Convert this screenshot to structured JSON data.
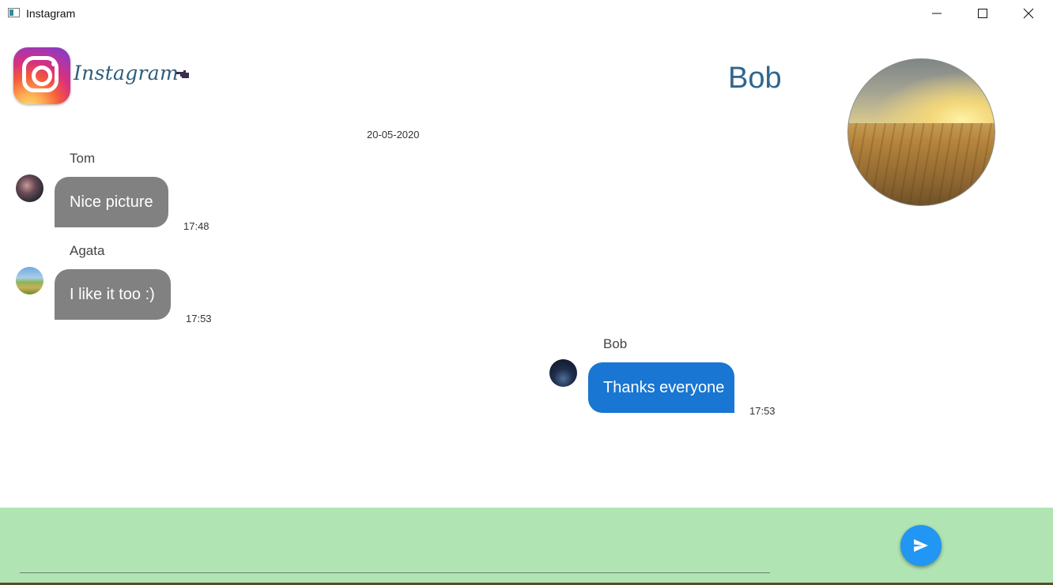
{
  "window": {
    "title": "Instagram",
    "controls": [
      "minimize-icon",
      "maximize-icon",
      "close-icon"
    ]
  },
  "header": {
    "brand": "Instagram",
    "logo_icon": "instagram-logo-icon",
    "pointer_icon": "pointing-hand-icon",
    "chat_partner_name": "Bob"
  },
  "conversation": {
    "date": "20-05-2020",
    "messages": [
      {
        "sender": "Tom",
        "text": "Nice picture",
        "time": "17:48",
        "own": false
      },
      {
        "sender": "Agata",
        "text": "I like it too :)",
        "time": "17:53",
        "own": false
      },
      {
        "sender": "Bob",
        "text": "Thanks everyone",
        "time": "17:53",
        "own": true
      }
    ]
  },
  "composer": {
    "input_value": "",
    "send_icon": "send-icon"
  },
  "colors": {
    "incoming_bubble": "#818181",
    "outgoing_bubble": "#1976d2",
    "composer_background": "#b0e5b3",
    "send_button": "#2196f3",
    "name_color": "#2f6690"
  }
}
